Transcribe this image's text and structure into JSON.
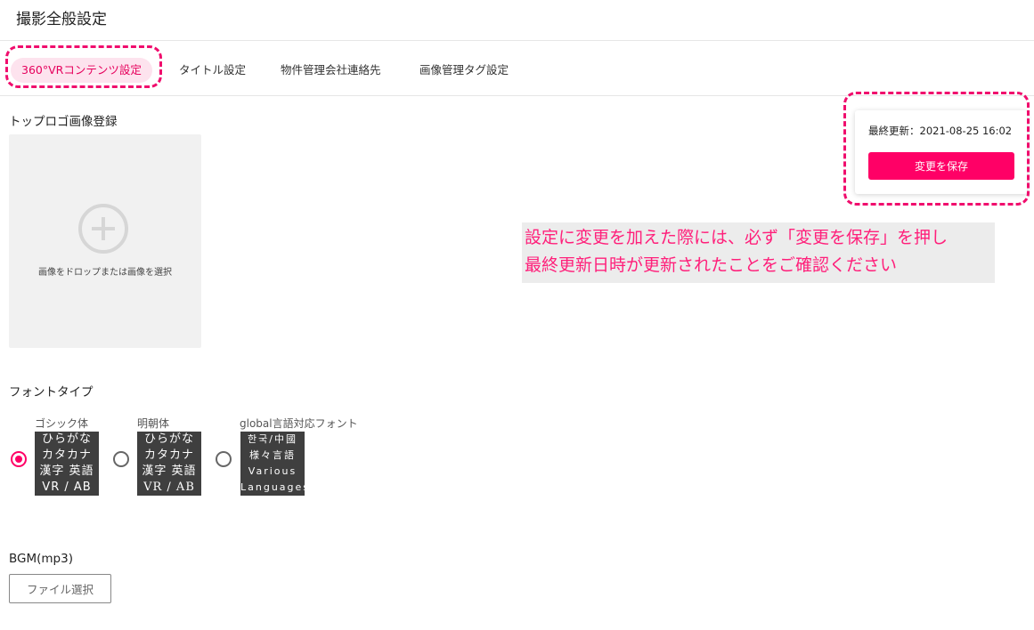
{
  "page": {
    "title": "撮影全般設定"
  },
  "tabs": [
    {
      "label": "360°VRコンテンツ設定",
      "active": true
    },
    {
      "label": "タイトル設定",
      "active": false
    },
    {
      "label": "物件管理会社連絡先",
      "active": false
    },
    {
      "label": "画像管理タグ設定",
      "active": false
    }
  ],
  "top_logo": {
    "label": "トップロゴ画像登録",
    "dropzone_text": "画像をドロップまたは画像を選択",
    "icon": "plus-circle-icon"
  },
  "save_panel": {
    "updated_label": "最終更新：2021-08-25 16:02",
    "save_label": "変更を保存"
  },
  "note": {
    "line1": "設定に変更を加えた際には、必ず「変更を保存」を押し",
    "line2": "最終更新日時が更新されたことをご確認ください"
  },
  "font_type": {
    "label": "フォントタイプ",
    "options": [
      {
        "name": "ゴシック体",
        "selected": true,
        "sample": [
          "ひらがな",
          "カタカナ",
          "漢字 英語",
          "VR / AB"
        ]
      },
      {
        "name": "明朝体",
        "selected": false,
        "sample": [
          "ひらがな",
          "カタカナ",
          "漢字 英語",
          "VR / AB"
        ]
      },
      {
        "name": "global言語対応フォント",
        "selected": false,
        "sample": [
          "한국/中國",
          "様々言語",
          "Various",
          "Languages"
        ]
      }
    ]
  },
  "bgm": {
    "label": "BGM(mp3)",
    "button_label": "ファイル選択"
  },
  "colors": {
    "accent": "#ff0066",
    "highlight": "#f00d6d",
    "tab_active_bg": "#fde3ee",
    "sample_bg": "#3f3f3f"
  }
}
